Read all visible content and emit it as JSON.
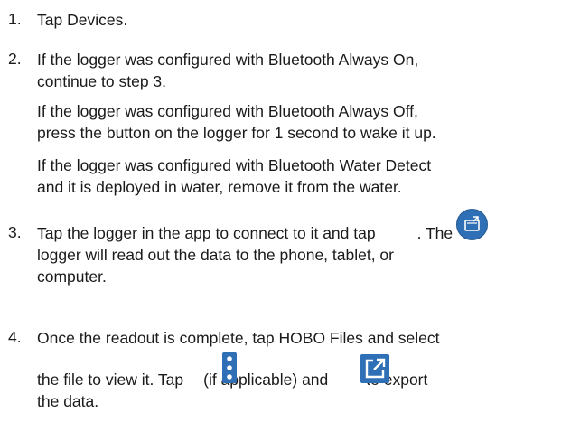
{
  "steps": [
    {
      "number": "1.",
      "lines": [
        "Tap Devices."
      ]
    },
    {
      "number": "2.",
      "lines": [
        "If the logger was configured with Bluetooth Always On,",
        "continue to step 3."
      ],
      "notes": [
        {
          "lines": [
            "If the logger was configured with Bluetooth Always Off,",
            "press the button on the logger for 1 second to wake it up."
          ]
        },
        {
          "lines": [
            "If the logger was configured with Bluetooth Water Detect",
            "and it is deployed in water, remove it from the water."
          ]
        }
      ]
    },
    {
      "number": "3.",
      "line1_before_icon": "Tap the logger in the app to connect to it and tap",
      "line1_after_icon": ". The",
      "lines_rest": [
        "logger will read out the data to the phone, tablet, or",
        "computer."
      ],
      "icon": "readout-icon"
    },
    {
      "number": "4.",
      "line1": "Once the readout is complete, tap HOBO Files and select",
      "line2_part1": "the file to view it. Tap",
      "line2_part2": "(if applicable) and",
      "line2_part3": "to export",
      "line3": "the data.",
      "icons": [
        "kebab-icon",
        "export-icon"
      ]
    }
  ],
  "colors": {
    "icon_blue": "#2f6fb5",
    "text": "#1a1a1a"
  }
}
